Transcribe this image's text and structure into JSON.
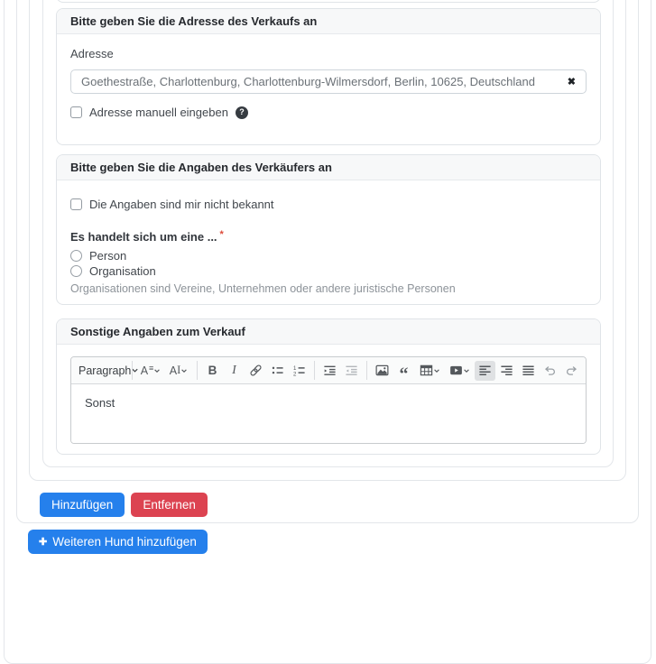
{
  "colors": {
    "primary": "#2580ec",
    "danger": "#dc4351",
    "required": "#dc4a39",
    "help_badge": "#363b41"
  },
  "address_card": {
    "title": "Bitte geben Sie die Adresse des Verkaufs an",
    "address_label": "Adresse",
    "address_value": "Goethestraße, Charlottenburg, Charlottenburg-Wilmersdorf, Berlin, 10625, Deutschland",
    "manual_entry_label": "Adresse manuell eingeben",
    "manual_entry_checked": false
  },
  "seller_card": {
    "title": "Bitte geben Sie die Angaben des Verkäufers an",
    "unknown_label": "Die Angaben sind mir nicht bekannt",
    "unknown_checked": false,
    "type_label": "Es handelt sich um eine ...",
    "required_marker": "*",
    "options": [
      {
        "label": "Person",
        "checked": false
      },
      {
        "label": "Organisation",
        "checked": false
      }
    ],
    "hint": "Organisationen sind Vereine, Unternehmen oder andere juristische Personen"
  },
  "notes_card": {
    "title": "Sonstige Angaben zum Verkauf",
    "editor": {
      "paragraph_label": "Paragraph",
      "content": "Sonst",
      "active_tool": "align-left",
      "disabled_tools": [
        "outdent",
        "undo",
        "redo"
      ],
      "toolbar": [
        "heading-dropdown",
        "font-size",
        "font-family",
        "bold",
        "italic",
        "link",
        "bulleted-list",
        "numbered-list",
        "indent",
        "outdent",
        "insert-image",
        "block-quote",
        "insert-table",
        "media-embed",
        "align-left",
        "align-right",
        "align-justify",
        "undo",
        "redo"
      ]
    }
  },
  "actions": {
    "add": "Hinzufügen",
    "remove": "Entfernen",
    "add_dog": "Weiteren Hund hinzufügen"
  },
  "icons": {
    "clear": "✖",
    "help": "?",
    "plus": "✚",
    "bold": "B",
    "italic": "I",
    "font_size_letter": "A",
    "font_size_lines": "≡",
    "font_family_a": "A",
    "font_family_i": "I",
    "quote": "“"
  }
}
